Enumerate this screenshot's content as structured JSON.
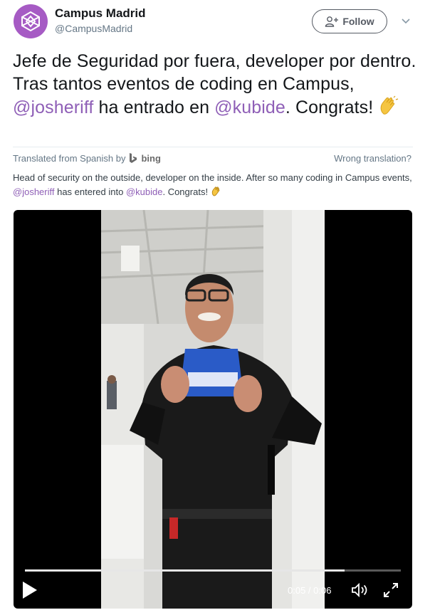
{
  "author": {
    "display_name": "Campus Madrid",
    "handle": "@CampusMadrid",
    "avatar_color": "#a65bc4"
  },
  "follow_button": {
    "label": "Follow"
  },
  "tweet": {
    "text_1": "Jefe de Seguridad por fuera, developer por dentro. Tras tantos eventos de coding en Campus, ",
    "mention_1": "@josheriff",
    "text_2": " ha entrado en ",
    "mention_2": "@kubide",
    "text_3": ". Congrats!",
    "emoji": "clapping-hands"
  },
  "translation_bar": {
    "label": "Translated from Spanish by",
    "provider": "bing",
    "wrong_link": "Wrong translation?"
  },
  "translation": {
    "text_1": "Head of security on the outside, developer on the inside. After so many coding in Campus events, ",
    "mention_1": "@josheriff",
    "text_2": " has entered into ",
    "mention_2": "@kubide",
    "text_3": ". Congrats!"
  },
  "video": {
    "time": "0:05 / 0:06",
    "progress": 0.85
  },
  "colors": {
    "mention": "#8f5fb7",
    "muted": "#657786"
  }
}
